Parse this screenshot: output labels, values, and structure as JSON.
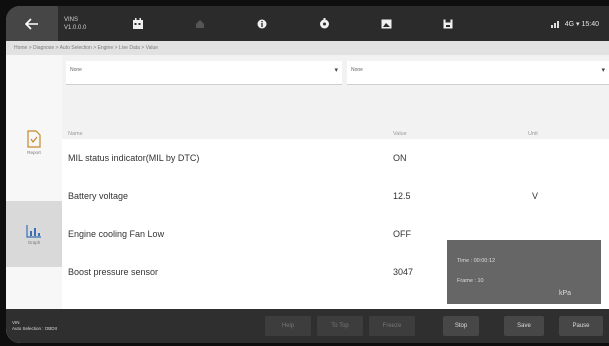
{
  "topbar": {
    "vin_line1": "VINS",
    "vin_line2": "V1.0.0.0",
    "status_text": "4G ▾ 15:40"
  },
  "breadcrumb": "Home > Diagnose > Auto Selection > Engine > Live Data > Value",
  "rail": {
    "doc_label": "Report",
    "graph_label": "Graph"
  },
  "filters": {
    "left_value": "None",
    "right_value": "None"
  },
  "table": {
    "headers": {
      "name": "Name",
      "value": "Value",
      "unit": "Unit"
    },
    "rows": [
      {
        "name": "MIL status indicator(MIL by DTC)",
        "value": "ON",
        "unit": ""
      },
      {
        "name": "Battery voltage",
        "value": "12.5",
        "unit": "V"
      },
      {
        "name": "Engine cooling Fan Low",
        "value": "OFF",
        "unit": ""
      },
      {
        "name": "Boost pressure sensor",
        "value": "3047",
        "unit": "kPa"
      }
    ]
  },
  "popup": {
    "line1": "Time : 00:00:12",
    "line2": "Frame : 10",
    "unit": "kPa"
  },
  "bottom": {
    "info1": "VIN",
    "info2": "Auto Selection : OBDII",
    "buttons": [
      "Help",
      "To Top",
      "Freeze",
      "Stop",
      "Save",
      "Pause"
    ]
  },
  "colors": {
    "topbar": "#2b2b2b",
    "bottombar": "#2f2f2f",
    "popup": "#666666"
  }
}
